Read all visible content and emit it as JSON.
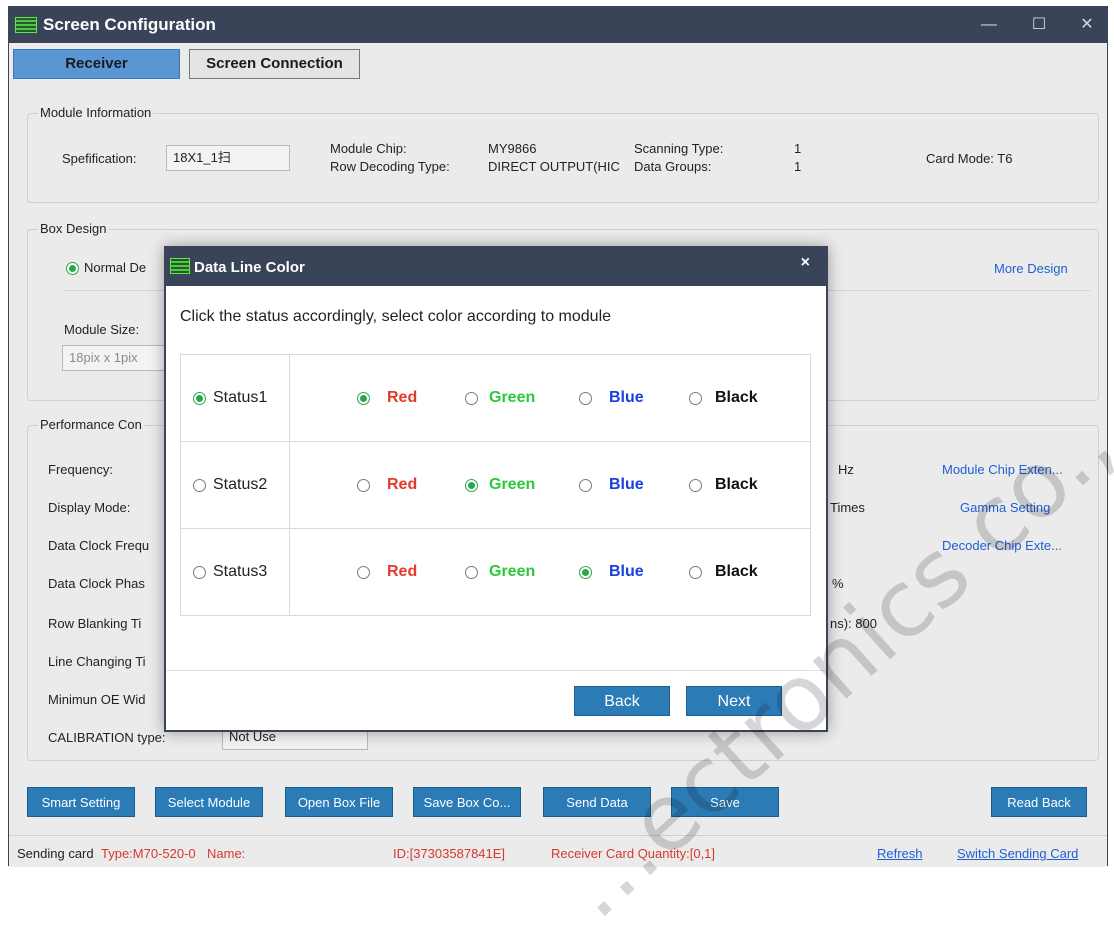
{
  "window": {
    "title": "Screen Configuration",
    "minimize": "—",
    "maximize": "☐",
    "close": "✕"
  },
  "tabs": [
    {
      "label": "Receiver",
      "active": true
    },
    {
      "label": "Screen Connection",
      "active": false
    }
  ],
  "module_info": {
    "title": "Module Information",
    "specification_label": "Spefification:",
    "specification_value": "18X1_1扫",
    "module_chip_label": "Module Chip:",
    "module_chip_value": "MY9866",
    "row_decoding_label": "Row Decoding Type:",
    "row_decoding_value": "DIRECT OUTPUT(HIC",
    "scanning_type_label": "Scanning Type:",
    "scanning_type_value": "1",
    "data_groups_label": "Data Groups:",
    "data_groups_value": "1",
    "card_mode": "Card Mode: T6"
  },
  "box_design": {
    "title": "Box Design",
    "normal_design_partial": "Normal De",
    "more_design": "More Design",
    "module_size_label": "Module Size:",
    "module_size_value": "18pix x 1pix"
  },
  "performance": {
    "title": "Performance Con",
    "labels": [
      "Frequency:",
      "Display Mode:",
      "Data Clock Frequ",
      "Data Clock Phas",
      "Row Blanking Ti",
      "Line Changing Ti",
      "Minimun OE Wid",
      "CALIBRATION type:"
    ],
    "calibration_value": "Not Use",
    "right_fragments": [
      "Hz",
      "Times",
      "%",
      "ns): 800"
    ],
    "links": [
      "Module Chip Exten...",
      "Gamma Setting",
      "Decoder Chip Exte..."
    ]
  },
  "buttons": [
    "Smart Setting",
    "Select Module",
    "Open Box File",
    "Save Box Co...",
    "Send Data",
    "Save",
    "Read Back"
  ],
  "status_bar": {
    "sending_card": "Sending card",
    "type": "Type:M70-520-0",
    "name": "Name:",
    "id": "ID:[37303587841E]",
    "receiver_qty": "Receiver Card Quantity:[0,1]",
    "refresh": "Refresh",
    "switch": "Switch Sending Card"
  },
  "dialog": {
    "title": "Data Line Color",
    "close": "×",
    "instruction": "Click the status accordingly, select color according to module",
    "color_labels": [
      "Red",
      "Green",
      "Blue",
      "Black"
    ],
    "rows": [
      {
        "status": "Status1",
        "status_checked": true,
        "selected_color": "Red"
      },
      {
        "status": "Status2",
        "status_checked": false,
        "selected_color": "Green"
      },
      {
        "status": "Status3",
        "status_checked": false,
        "selected_color": "Blue"
      }
    ],
    "back": "Back",
    "next": "Next"
  },
  "colors": {
    "titlebar": "#3a4458",
    "accent": "#2b7bb6",
    "active_tab": "#5a96d4",
    "red": "#e53a2b",
    "green": "#2dc83a",
    "blue": "#1a3fe0",
    "link": "#1f5fd6"
  },
  "watermark": "…ectronics co.,"
}
